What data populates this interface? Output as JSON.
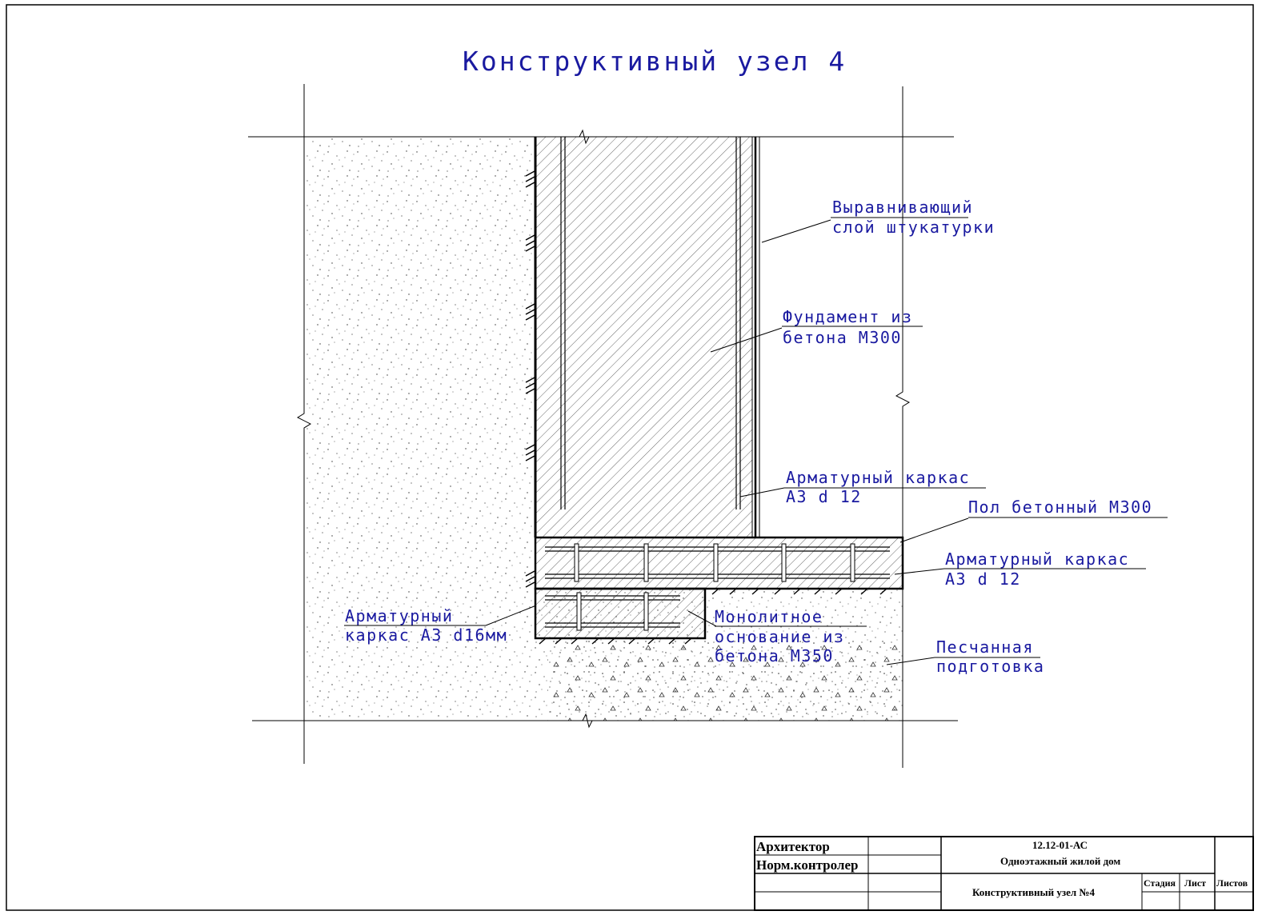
{
  "drawing": {
    "title": "Конструктивный узел 4",
    "callouts": {
      "plaster": [
        "Выравнивающий",
        "слой штукатурки"
      ],
      "foundation": [
        "Фундамент из",
        "бетона М300"
      ],
      "wall_rebar": [
        "Арматурный каркас",
        "А3 d 12"
      ],
      "floor": [
        "Пол бетонный М300"
      ],
      "floor_rebar": [
        "Арматурный каркас",
        "А3 d 12"
      ],
      "footing_rebar": [
        "Арматурный",
        "каркас А3 d16мм"
      ],
      "monolith_base": [
        "Монолитное",
        "основание из",
        "бетона М350"
      ],
      "sand_bed": [
        "Песчанная",
        "подготовка"
      ]
    }
  },
  "title_block": {
    "architect_label": "Архитектор",
    "norm_control_label": "Норм.контролер",
    "project_code": "12.12-01-АС",
    "project_name": "Одноэтажный жилой дом",
    "sheet_name": "Конструктивный узел №4",
    "stage_label": "Стадия",
    "sheet_label": "Лист",
    "sheets_label": "Листов"
  }
}
